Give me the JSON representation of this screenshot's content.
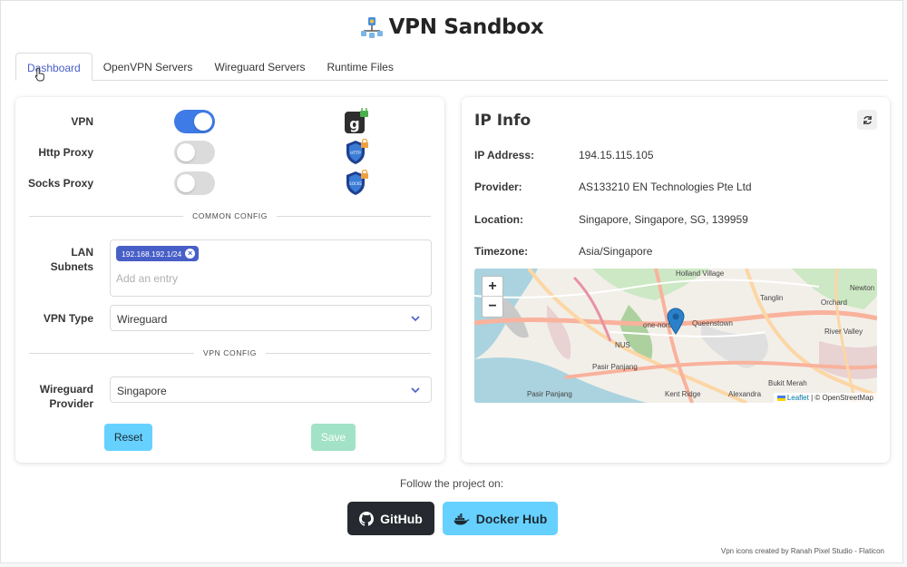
{
  "app": {
    "title": "VPN Sandbox"
  },
  "tabs": [
    {
      "label": "Dashboard",
      "active": true
    },
    {
      "label": "OpenVPN Servers",
      "active": false
    },
    {
      "label": "Wireguard Servers",
      "active": false
    },
    {
      "label": "Runtime Files",
      "active": false
    }
  ],
  "toggles": [
    {
      "label": "VPN",
      "on": true,
      "icon": "vpn-locked-icon"
    },
    {
      "label": "Http Proxy",
      "on": false,
      "icon": "http-shield-locked-icon"
    },
    {
      "label": "Socks Proxy",
      "on": false,
      "icon": "socks-shield-locked-icon"
    }
  ],
  "common_config": {
    "heading": "COMMON CONFIG",
    "lan_subnets_label": "LAN Subnets",
    "lan_subnets": [
      "192.168.192.1/24"
    ],
    "lan_subnets_placeholder": "Add an entry",
    "vpn_type_label": "VPN Type",
    "vpn_type_value": "Wireguard"
  },
  "vpn_config": {
    "heading": "VPN CONFIG",
    "provider_label_line1": "Wireguard",
    "provider_label_line2": "Provider",
    "provider_value": "Singapore"
  },
  "actions": {
    "reset_label": "Reset",
    "save_label": "Save"
  },
  "ip_info": {
    "title": "IP Info",
    "rows": [
      {
        "key": "IP Address:",
        "value": "194.15.115.105"
      },
      {
        "key": "Provider:",
        "value": "AS133210 EN Technologies Pte Ltd"
      },
      {
        "key": "Location:",
        "value": "Singapore, Singapore, SG, 139959"
      },
      {
        "key": "Timezone:",
        "value": "Asia/Singapore"
      }
    ]
  },
  "map": {
    "zoom_in": "+",
    "zoom_out": "−",
    "attribution_link": "Leaflet",
    "attribution_text": "| © OpenStreetMap",
    "labels": [
      "Holland Village",
      "Tanglin",
      "Orchard",
      "Newton",
      "River Valley",
      "Queenstown",
      "one-north",
      "Pasir Panjang",
      "Bukit Merah",
      "Alexandra",
      "Kent Ridge",
      "NUS",
      "Pasir Panjang"
    ]
  },
  "footer": {
    "follow_text": "Follow the project on:",
    "github_label": "GitHub",
    "docker_label": "Docker Hub",
    "credits": "Vpn icons created by Ranah Pixel Studio - Flaticon"
  },
  "colors": {
    "accent": "#485fc7",
    "toggle_on": "#3e7be6",
    "info_button": "#66d1ff",
    "success_button": "#48c78e",
    "dark_button": "#262a30"
  }
}
